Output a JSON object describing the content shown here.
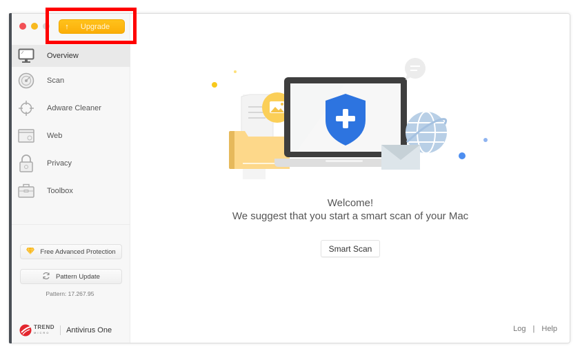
{
  "window": {
    "traffic_lights": [
      "close",
      "minimize",
      "zoom"
    ]
  },
  "toolbar": {
    "upgrade_label": "Upgrade",
    "upgrade_icon": "arrow-up-icon"
  },
  "sidebar": {
    "items": [
      {
        "label": "Overview",
        "icon": "monitor-icon",
        "active": true
      },
      {
        "label": "Scan",
        "icon": "radar-icon",
        "active": false
      },
      {
        "label": "Adware Cleaner",
        "icon": "crosshair-icon",
        "active": false
      },
      {
        "label": "Web",
        "icon": "browser-window-icon",
        "active": false
      },
      {
        "label": "Privacy",
        "icon": "lock-icon",
        "active": false
      },
      {
        "label": "Toolbox",
        "icon": "toolbox-icon",
        "active": false
      }
    ],
    "free_advanced_protection_label": "Free Advanced Protection",
    "pattern_update_label": "Pattern Update",
    "pattern_version": "Pattern: 17.267.95",
    "brand": {
      "company_line1": "TREND",
      "company_line2": "MICRO",
      "product": "Antivirus One"
    }
  },
  "main": {
    "welcome_title": "Welcome!",
    "welcome_subtitle": "We suggest that you start a smart scan of your Mac",
    "smart_scan_label": "Smart Scan",
    "footer": {
      "log_label": "Log",
      "separator": "|",
      "help_label": "Help"
    }
  },
  "colors": {
    "accent_upgrade": "#fbb20f",
    "shield_blue": "#2d74e0",
    "highlight_red": "#ff0000"
  }
}
